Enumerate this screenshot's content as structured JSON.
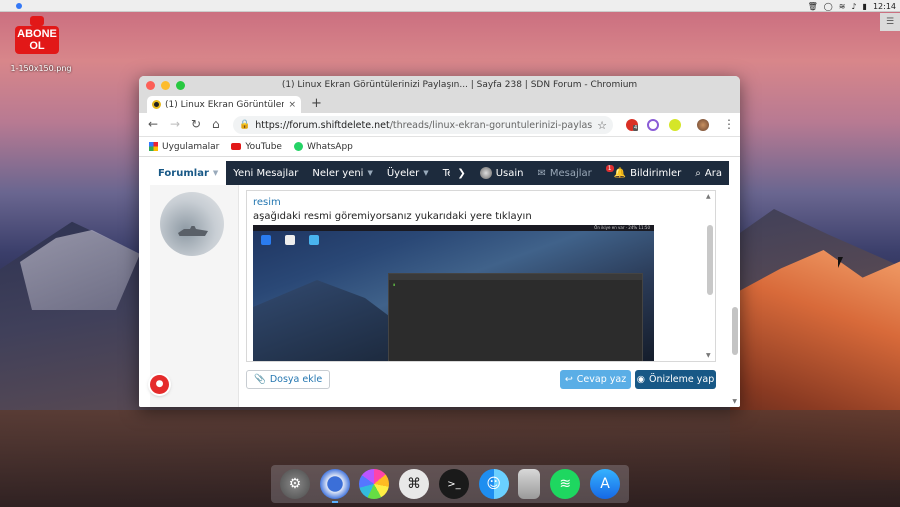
{
  "menubar": {
    "clock": "12:14"
  },
  "desktop": {
    "file_icon_line1": "ABONE",
    "file_icon_line2": "OL",
    "file_name": "1-150x150.png"
  },
  "window": {
    "title": "(1) Linux Ekran Görüntülerinizi Paylaşın... | Sayfa 238 | SDN Forum - Chromium"
  },
  "tab": {
    "title": "(1) Linux Ekran Görüntülerinin",
    "close": "×",
    "new_tab": "+"
  },
  "toolbar": {
    "url_host": "https://forum.shiftdelete.net",
    "url_path": "/threads/linux-ekran-goruntulerinizi-paylasin...",
    "ext_badge": "4"
  },
  "bookmarks": [
    {
      "label": "Uygulamalar",
      "icon": "apps-grid-icon"
    },
    {
      "label": "YouTube",
      "icon": "youtube-icon"
    },
    {
      "label": "WhatsApp",
      "icon": "whatsapp-icon"
    }
  ],
  "forum_nav": {
    "forums": "Forumlar",
    "new_posts": "Yeni Mesajlar",
    "whats_new": "Neler yeni",
    "members": "Üyeler",
    "technology": "Teknoloji",
    "user": "Usain",
    "messages": "Mesajlar",
    "alerts": "Bildirimler",
    "alerts_badge": "1",
    "search": "Ara"
  },
  "editor": {
    "link_text": "resim",
    "paragraph": "aşağıdaki resmi göremiyorsanız yukarıdaki yere tıklayın",
    "screenshot_topbar": "Ön ikiye en var  ·  24%  11:50"
  },
  "buttons": {
    "attach": "Dosya ekle",
    "reply": "Cevap yaz",
    "preview": "Önizleme yap"
  },
  "colors": {
    "nav_bg": "#1d2b3d",
    "accent": "#185886",
    "reply_btn": "#5aaee6"
  }
}
